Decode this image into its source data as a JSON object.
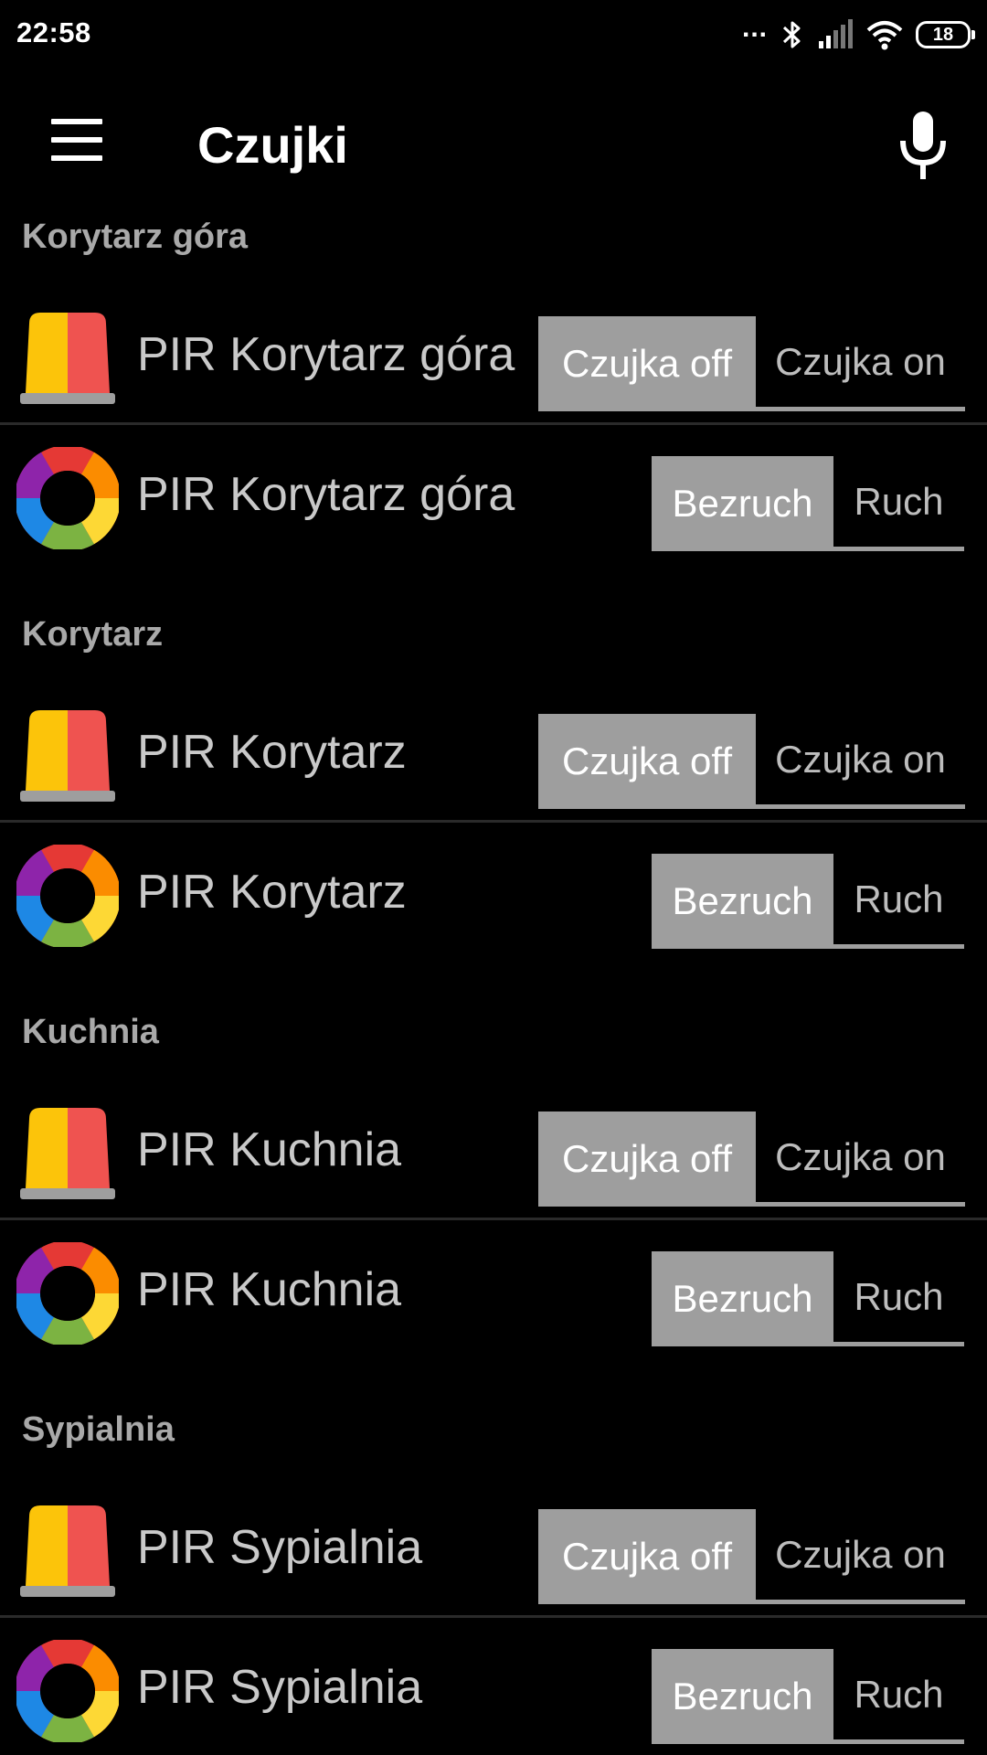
{
  "status_bar": {
    "time": "22:58",
    "dots": "...",
    "battery": "18",
    "icons": [
      "bluetooth-icon",
      "signal-icon",
      "wifi-icon",
      "battery-icon"
    ]
  },
  "app_bar": {
    "title": "Czujki",
    "menu_icon": "hamburger-menu-icon",
    "mic_icon": "microphone-icon"
  },
  "colors": {
    "background": "#000000",
    "toggle_active": "#9e9e9e",
    "header_text": "#a9a9a9",
    "item_text": "#c9c9c9"
  },
  "sections": [
    {
      "header": "Korytarz góra",
      "alarm": {
        "name": "PIR Korytarz góra",
        "off_label": "Czujka off",
        "on_label": "Czujka on",
        "selected": "off"
      },
      "motion": {
        "name": "PIR Korytarz góra",
        "idle_label": "Bezruch",
        "motion_label": "Ruch",
        "selected": "idle"
      }
    },
    {
      "header": "Korytarz",
      "alarm": {
        "name": "PIR Korytarz",
        "off_label": "Czujka off",
        "on_label": "Czujka on",
        "selected": "off"
      },
      "motion": {
        "name": "PIR Korytarz",
        "idle_label": "Bezruch",
        "motion_label": "Ruch",
        "selected": "idle"
      }
    },
    {
      "header": "Kuchnia",
      "alarm": {
        "name": "PIR Kuchnia",
        "off_label": "Czujka off",
        "on_label": "Czujka on",
        "selected": "off"
      },
      "motion": {
        "name": "PIR Kuchnia",
        "idle_label": "Bezruch",
        "motion_label": "Ruch",
        "selected": "idle"
      }
    },
    {
      "header": "Sypialnia",
      "alarm": {
        "name": "PIR Sypialnia",
        "off_label": "Czujka off",
        "on_label": "Czujka on",
        "selected": "off"
      },
      "motion": {
        "name": "PIR Sypialnia",
        "idle_label": "Bezruch",
        "motion_label": "Ruch",
        "selected": "idle"
      }
    }
  ]
}
